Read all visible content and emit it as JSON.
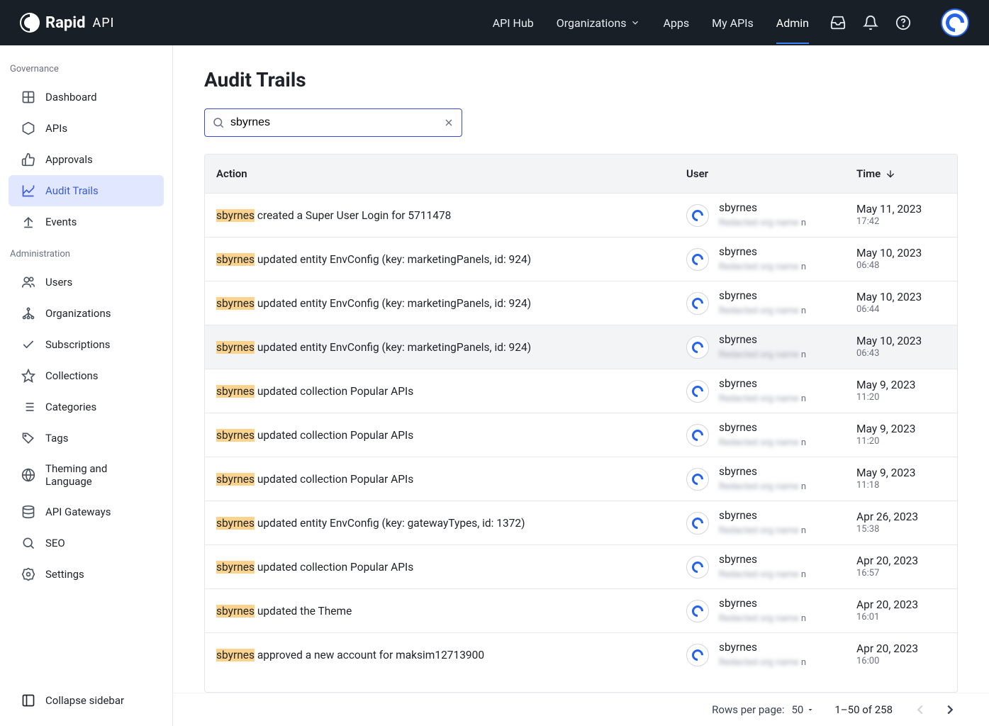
{
  "header": {
    "logo_text": "Rapid",
    "logo_suffix": "API",
    "nav": [
      {
        "label": "API Hub"
      },
      {
        "label": "Organizations",
        "chevron": true
      },
      {
        "label": "Apps"
      },
      {
        "label": "My APIs"
      },
      {
        "label": "Admin",
        "active": true
      }
    ]
  },
  "sidebar": {
    "group1_label": "Governance",
    "group1_items": [
      {
        "label": "Dashboard",
        "icon": "grid"
      },
      {
        "label": "APIs",
        "icon": "hex"
      },
      {
        "label": "Approvals",
        "icon": "thumbs-up"
      },
      {
        "label": "Audit Trails",
        "icon": "chart",
        "active": true
      },
      {
        "label": "Events",
        "icon": "upload"
      }
    ],
    "group2_label": "Administration",
    "group2_items": [
      {
        "label": "Users",
        "icon": "users"
      },
      {
        "label": "Organizations",
        "icon": "org"
      },
      {
        "label": "Subscriptions",
        "icon": "check"
      },
      {
        "label": "Collections",
        "icon": "star"
      },
      {
        "label": "Categories",
        "icon": "list"
      },
      {
        "label": "Tags",
        "icon": "tag"
      },
      {
        "label": "Theming and Language",
        "icon": "globe"
      },
      {
        "label": "API Gateways",
        "icon": "db"
      },
      {
        "label": "SEO",
        "icon": "search"
      },
      {
        "label": "Settings",
        "icon": "gear"
      }
    ],
    "collapse_label": "Collapse sidebar"
  },
  "page": {
    "title": "Audit Trails",
    "search_value": "sbyrnes",
    "columns": {
      "action": "Action",
      "user": "User",
      "time": "Time"
    }
  },
  "rows": [
    {
      "highlight_term": "sbyrnes",
      "action_rest": " created a Super User Login for 5711478",
      "user": "sbyrnes",
      "date": "May 11, 2023",
      "time": "17:42",
      "row_highlight": false
    },
    {
      "highlight_term": "sbyrnes",
      "action_rest": " updated entity EnvConfig (key: marketingPanels, id: 924)",
      "user": "sbyrnes",
      "date": "May 10, 2023",
      "time": "06:48",
      "row_highlight": false
    },
    {
      "highlight_term": "sbyrnes",
      "action_rest": " updated entity EnvConfig (key: marketingPanels, id: 924)",
      "user": "sbyrnes",
      "date": "May 10, 2023",
      "time": "06:44",
      "row_highlight": false
    },
    {
      "highlight_term": "sbyrnes",
      "action_rest": " updated entity EnvConfig (key: marketingPanels, id: 924)",
      "user": "sbyrnes",
      "date": "May 10, 2023",
      "time": "06:43",
      "row_highlight": true
    },
    {
      "highlight_term": "sbyrnes",
      "action_rest": " updated collection Popular APIs",
      "user": "sbyrnes",
      "date": "May 9, 2023",
      "time": "11:20",
      "row_highlight": false
    },
    {
      "highlight_term": "sbyrnes",
      "action_rest": " updated collection Popular APIs",
      "user": "sbyrnes",
      "date": "May 9, 2023",
      "time": "11:20",
      "row_highlight": false
    },
    {
      "highlight_term": "sbyrnes",
      "action_rest": " updated collection Popular APIs",
      "user": "sbyrnes",
      "date": "May 9, 2023",
      "time": "11:18",
      "row_highlight": false
    },
    {
      "highlight_term": "sbyrnes",
      "action_rest": " updated entity EnvConfig (key: gatewayTypes, id: 1372)",
      "user": "sbyrnes",
      "date": "Apr 26, 2023",
      "time": "15:38",
      "row_highlight": false
    },
    {
      "highlight_term": "sbyrnes",
      "action_rest": " updated collection Popular APIs",
      "user": "sbyrnes",
      "date": "Apr 20, 2023",
      "time": "16:57",
      "row_highlight": false
    },
    {
      "highlight_term": "sbyrnes",
      "action_rest": " updated the Theme",
      "user": "sbyrnes",
      "date": "Apr 20, 2023",
      "time": "16:01",
      "row_highlight": false
    },
    {
      "highlight_term": "sbyrnes",
      "action_rest": " approved a new account for maksim12713900",
      "user": "sbyrnes",
      "date": "Apr 20, 2023",
      "time": "16:00",
      "row_highlight": false
    }
  ],
  "pagination": {
    "rows_label": "Rows per page:",
    "rows_value": "50",
    "range": "1–50 of 258"
  },
  "user_secondary_placeholder": "Redacted org name",
  "user_secondary_suffix": "n"
}
